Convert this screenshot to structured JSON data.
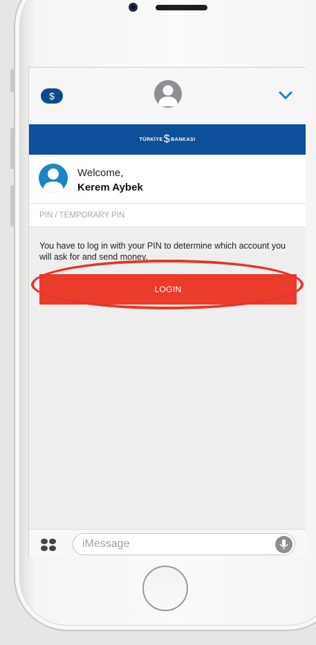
{
  "header": {
    "app_badge_symbol": "$",
    "contact_avatar_icon": "person-silhouette-icon",
    "expand_icon": "chevron-down-icon"
  },
  "bank_banner": {
    "name_left": "TÜRKİYE",
    "name_mark": "$",
    "name_right": "BANKASI"
  },
  "welcome": {
    "label": "Welcome,",
    "user_name": "Kerem Aybek"
  },
  "pin": {
    "placeholder": "PIN / TEMPORARY PIN",
    "value": ""
  },
  "info": {
    "text": "You have to log in with your PIN to determine which account you will ask for and send money."
  },
  "login": {
    "label": "LOGIN"
  },
  "compose": {
    "placeholder": "iMessage",
    "apps_icon": "apps-grid-icon",
    "mic_icon": "microphone-icon"
  },
  "colors": {
    "bank_blue": "#0e4f9a",
    "login_red": "#ec3a2b",
    "highlight_red": "#e8332a",
    "avatar_blue": "#1a86c8"
  }
}
